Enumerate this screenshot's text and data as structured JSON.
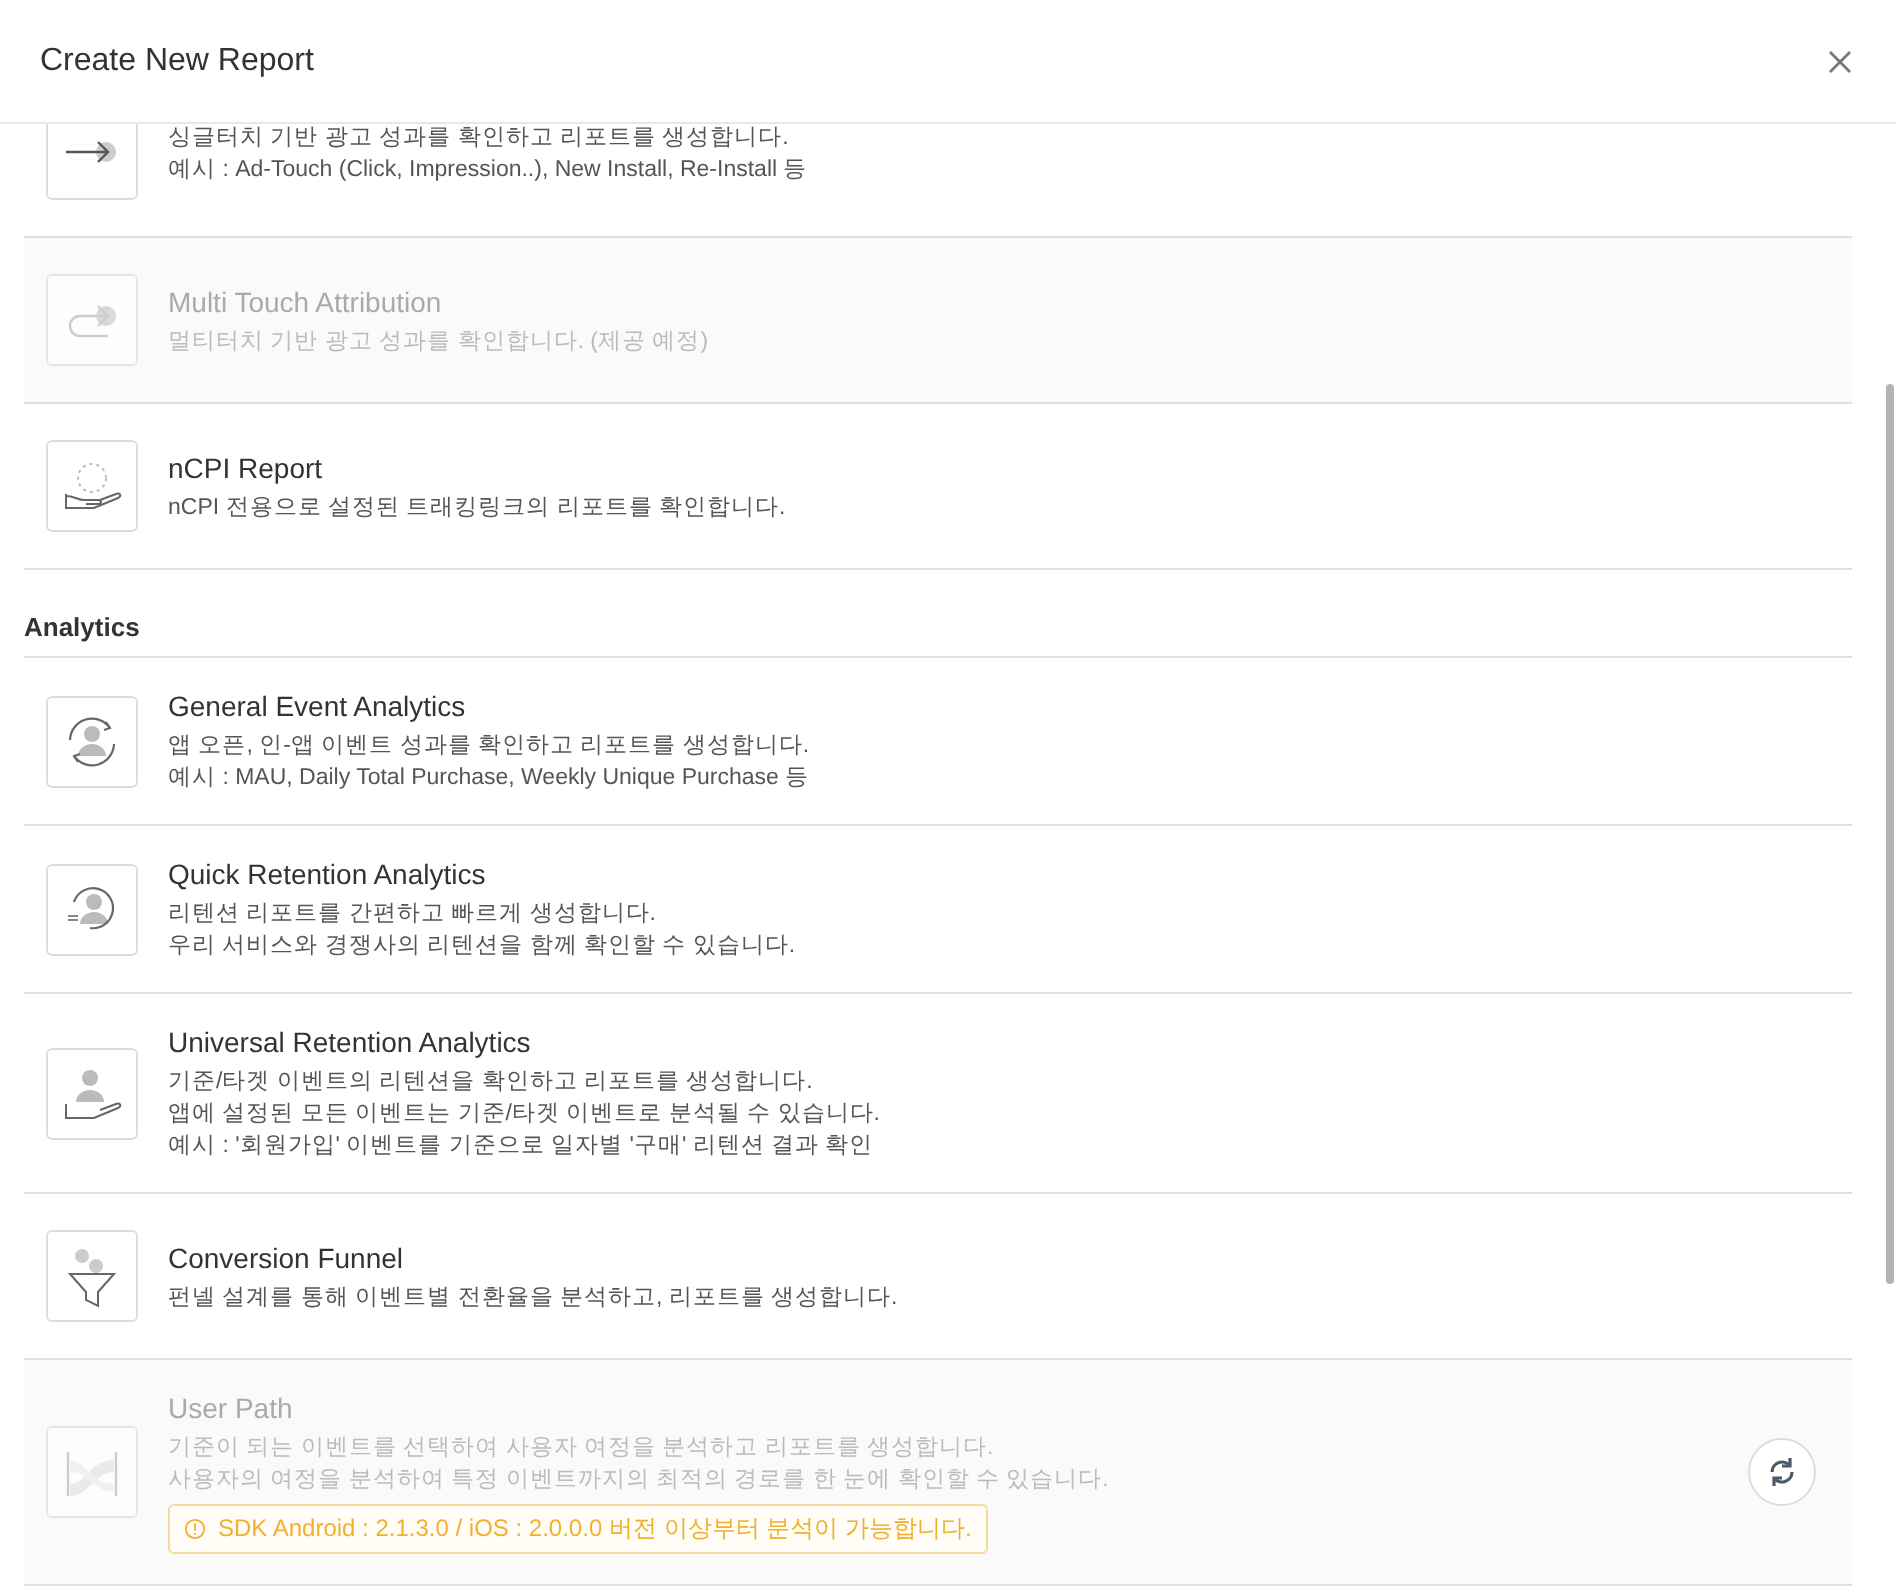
{
  "dialog": {
    "title": "Create New Report"
  },
  "sections": [
    {
      "items": [
        {
          "lines": [
            "싱글터치 기반 광고 성과를 확인하고 리포트를 생성합니다.",
            "예시 : Ad-Touch (Click, Impression..), New Install, Re-Install 등"
          ],
          "disabled": false
        },
        {
          "title": "Multi Touch Attribution",
          "lines": [
            "멀티터치 기반 광고 성과를 확인합니다. (제공 예정)"
          ],
          "disabled": true
        },
        {
          "title": "nCPI Report",
          "lines": [
            "nCPI 전용으로 설정된 트래킹링크의 리포트를 확인합니다."
          ],
          "disabled": false
        }
      ]
    },
    {
      "heading": "Analytics",
      "items": [
        {
          "title": "General Event Analytics",
          "lines": [
            "앱 오픈, 인-앱 이벤트 성과를 확인하고 리포트를 생성합니다.",
            "예시 : MAU, Daily Total Purchase, Weekly Unique Purchase 등"
          ],
          "disabled": false
        },
        {
          "title": "Quick Retention Analytics",
          "lines": [
            "리텐션 리포트를 간편하고 빠르게 생성합니다.",
            "우리 서비스와 경쟁사의 리텐션을 함께 확인할 수 있습니다."
          ],
          "disabled": false
        },
        {
          "title": "Universal Retention Analytics",
          "lines": [
            "기준/타겟 이벤트의 리텐션을 확인하고 리포트를 생성합니다.",
            "앱에 설정된 모든 이벤트는 기준/타겟 이벤트로 분석될 수 있습니다.",
            "예시 : '회원가입' 이벤트를 기준으로 일자별 '구매' 리텐션 결과 확인"
          ],
          "disabled": false
        },
        {
          "title": "Conversion Funnel",
          "lines": [
            "펀넬 설계를 통해 이벤트별 전환율을 분석하고, 리포트를 생성합니다."
          ],
          "disabled": false
        },
        {
          "title": "User Path",
          "lines": [
            "기준이 되는 이벤트를 선택하여 사용자 여정을 분석하고 리포트를 생성합니다.",
            "사용자의 여정을 분석하여 특정 이벤트까지의 최적의 경로를 한 눈에 확인할 수 있습니다."
          ],
          "disabled": true,
          "notice": "SDK Android : 2.1.3.0 / iOS : 2.0.0.0 버전 이상부터 분석이 가능합니다.",
          "refresh": true
        }
      ]
    }
  ]
}
